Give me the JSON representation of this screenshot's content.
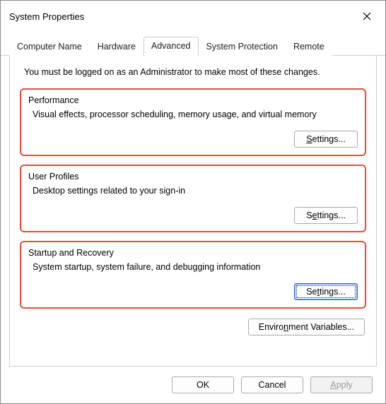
{
  "window": {
    "title": "System Properties"
  },
  "tabs": {
    "computer_name": "Computer Name",
    "hardware": "Hardware",
    "advanced": "Advanced",
    "system_protection": "System Protection",
    "remote": "Remote"
  },
  "intro": "You must be logged on as an Administrator to make most of these changes.",
  "groups": {
    "performance": {
      "title": "Performance",
      "desc": "Visual effects, processor scheduling, memory usage, and virtual memory",
      "button_pre": "S",
      "button_post": "ettings..."
    },
    "user_profiles": {
      "title": "User Profiles",
      "desc": "Desktop settings related to your sign-in",
      "button_pre": "S",
      "button_post": "ettings..."
    },
    "startup": {
      "title": "Startup and Recovery",
      "desc": "System startup, system failure, and debugging information",
      "button_pre": "Se",
      "button_post": "tings..."
    }
  },
  "env_button_pre": "Enviro",
  "env_button_post": "ment Variables...",
  "footer": {
    "ok": "OK",
    "cancel": "Cancel",
    "apply_pre": "A",
    "apply_post": "pply"
  }
}
